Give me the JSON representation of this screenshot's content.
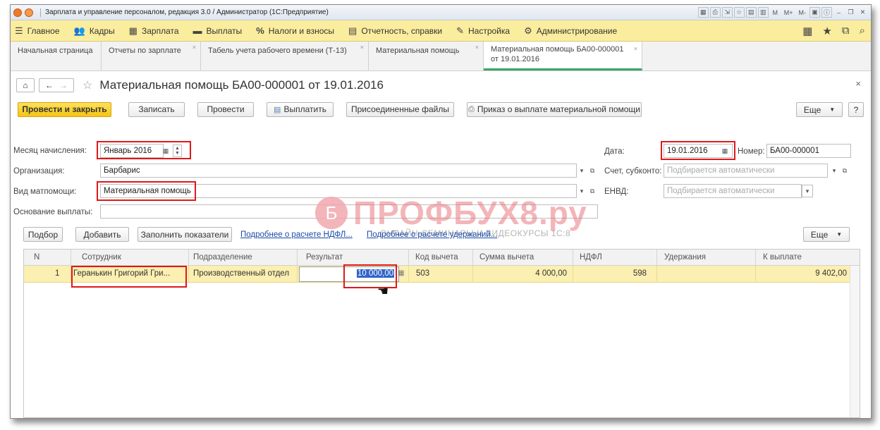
{
  "titlebar": {
    "title": "Зарплата и управление персоналом, редакция 3.0 / Администратор  (1С:Предприятие)",
    "controls": [
      "M",
      "M+",
      "M-"
    ]
  },
  "main_menu": [
    {
      "icon": "menu-icon",
      "label": "Главное"
    },
    {
      "icon": "people-icon",
      "label": "Кадры"
    },
    {
      "icon": "calculator-icon",
      "label": "Зарплата"
    },
    {
      "icon": "wallet-icon",
      "label": "Выплаты"
    },
    {
      "icon": "percent-icon",
      "label": "Налоги и взносы"
    },
    {
      "icon": "report-icon",
      "label": "Отчетность, справки"
    },
    {
      "icon": "wrench-icon",
      "label": "Настройка"
    },
    {
      "icon": "gear-icon",
      "label": "Администрирование"
    }
  ],
  "tabs": [
    {
      "label": "Начальная страница",
      "closable": false
    },
    {
      "label": "Отчеты по зарплате",
      "closable": true
    },
    {
      "label": "Табель учета рабочего времени (Т-13)",
      "closable": true
    },
    {
      "label": "Материальная помощь",
      "closable": true
    },
    {
      "label_line1": "Материальная помощь БА00-000001",
      "label_line2": "от 19.01.2016",
      "closable": true,
      "active": true
    }
  ],
  "form": {
    "title": "Материальная помощь БА00-000001 от 19.01.2016"
  },
  "toolbar": {
    "post_close": "Провести и закрыть",
    "save": "Записать",
    "post": "Провести",
    "pay": "Выплатить",
    "attached": "Присоединенные файлы",
    "order": "Приказ о выплате материальной помощи",
    "more": "Еще",
    "help": "?"
  },
  "fields": {
    "month_label": "Месяц начисления:",
    "month_value": "Январь 2016",
    "org_label": "Организация:",
    "org_value": "Барбарис",
    "aid_type_label": "Вид матпомощи:",
    "aid_type_value": "Материальная помощь",
    "basis_label": "Основание выплаты:",
    "basis_value": "",
    "date_label": "Дата:",
    "date_value": "19.01.2016",
    "number_label": "Номер:",
    "number_value": "БА00-000001",
    "account_label": "Счет, субконто:",
    "account_placeholder": "Подбирается автоматически",
    "envd_label": "ЕНВД:",
    "envd_placeholder": "Подбирается автоматически"
  },
  "table_toolbar": {
    "pick": "Подбор",
    "add": "Добавить",
    "fill": "Заполнить показатели",
    "ndfl_link": "Подробнее о расчете НДФЛ...",
    "deduct_link": "Подробнее о расчете удержаний...",
    "more": "Еще"
  },
  "table": {
    "columns": [
      "N",
      "Сотрудник",
      "Подразделение",
      "Результат",
      "Код вычета",
      "Сумма вычета",
      "НДФЛ",
      "Удержания",
      "К выплате"
    ],
    "rows": [
      {
        "n": "1",
        "employee": "Геранькин Григорий Гри...",
        "dept": "Производственный отдел",
        "result": "10 000,00",
        "code": "503",
        "deduct_sum": "4 000,00",
        "ndfl": "598",
        "withhold": "",
        "pay": "9 402,00"
      }
    ]
  },
  "watermark": {
    "logo_letter": "Б",
    "text": "ПРОФБУХ8.ру",
    "sub": "ОНЛАЙН-СЕМИНАРЫ И ВИДЕОКУРСЫ 1С:8"
  },
  "colors": {
    "menu_bg": "#fbed9e",
    "primary_button": "#f6c512",
    "selected_row": "#fbefb1",
    "highlight_red": "#e01818",
    "link": "#1a4aa8"
  }
}
